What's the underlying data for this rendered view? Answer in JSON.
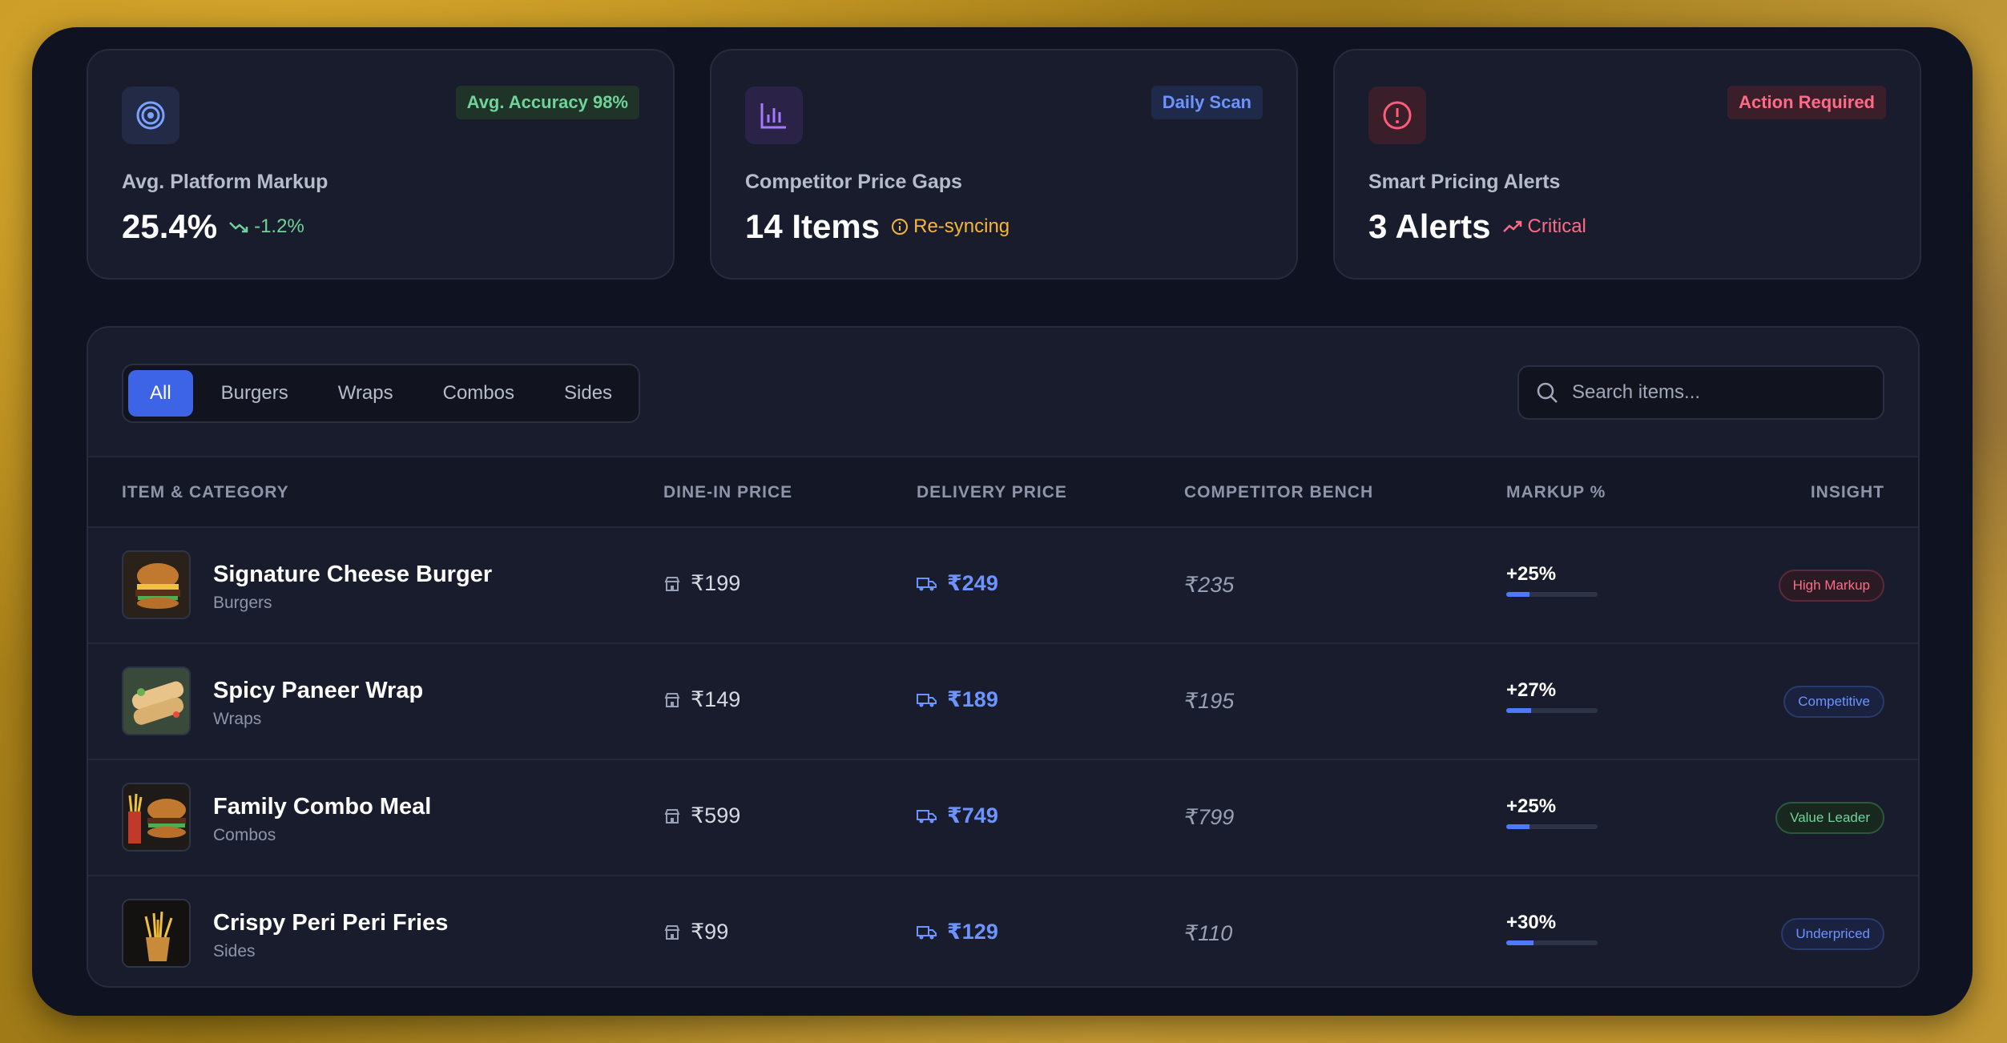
{
  "stats": [
    {
      "label": "Avg. Platform Markup",
      "value": "25.4%",
      "trend": "-1.2%",
      "badge": "Avg. Accuracy 98%",
      "icon": "target-icon",
      "accent": "#7aa2ff",
      "badge_color": "#6fd39a"
    },
    {
      "label": "Competitor Price Gaps",
      "value": "14 Items",
      "trend": "Re-syncing",
      "badge": "Daily Scan",
      "icon": "bar-chart-icon",
      "accent": "#a478ff",
      "badge_color": "#6d93ff"
    },
    {
      "label": "Smart Pricing Alerts",
      "value": "3 Alerts",
      "trend": "Critical",
      "badge": "Action Required",
      "icon": "alert-circle-icon",
      "accent": "#ff5c7a",
      "badge_color": "#ff6b86"
    }
  ],
  "tabs": [
    "All",
    "Burgers",
    "Wraps",
    "Combos",
    "Sides"
  ],
  "active_tab": "All",
  "search": {
    "placeholder": "Search items..."
  },
  "columns": [
    "ITEM & CATEGORY",
    "DINE-IN PRICE",
    "DELIVERY PRICE",
    "COMPETITOR BENCH",
    "MARKUP %",
    "INSIGHT"
  ],
  "rows": [
    {
      "name": "Signature Cheese Burger",
      "category": "Burgers",
      "dine_in": "₹199",
      "delivery": "₹249",
      "competitor": "₹235",
      "markup": "+25%",
      "markup_value": 25,
      "insight": "High Markup",
      "insight_color": "#ff6b86"
    },
    {
      "name": "Spicy Paneer Wrap",
      "category": "Wraps",
      "dine_in": "₹149",
      "delivery": "₹189",
      "competitor": "₹195",
      "markup": "+27%",
      "markup_value": 27,
      "insight": "Competitive",
      "insight_color": "#6d93ff"
    },
    {
      "name": "Family Combo Meal",
      "category": "Combos",
      "dine_in": "₹599",
      "delivery": "₹749",
      "competitor": "₹799",
      "markup": "+25%",
      "markup_value": 25,
      "insight": "Value Leader",
      "insight_color": "#6fd39a"
    },
    {
      "name": "Crispy Peri Peri Fries",
      "category": "Sides",
      "dine_in": "₹99",
      "delivery": "₹129",
      "competitor": "₹110",
      "markup": "+30%",
      "markup_value": 30,
      "insight": "Underpriced",
      "insight_color": "#6d93ff"
    }
  ]
}
